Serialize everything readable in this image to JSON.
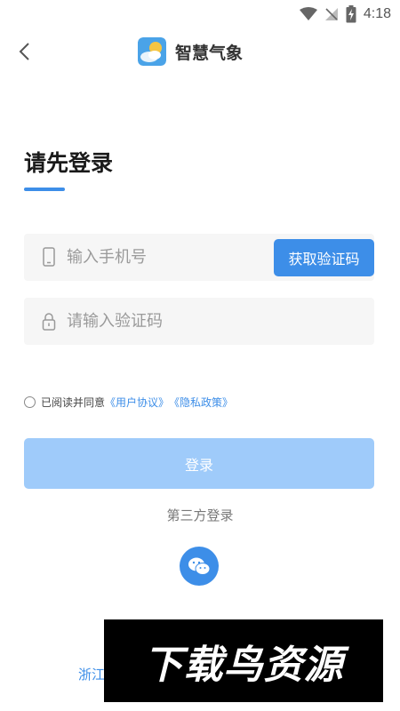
{
  "status_bar": {
    "time": "4:18",
    "icons": [
      "wifi-icon",
      "signal-off-icon",
      "battery-charging-icon"
    ]
  },
  "nav": {
    "back_icon": "chevron-left-icon",
    "app_title": "智慧气象"
  },
  "login": {
    "title": "请先登录",
    "phone_placeholder": "输入手机号",
    "get_code_label": "获取验证码",
    "code_placeholder": "请输入验证码",
    "agreement_prefix": "已阅读并同意",
    "user_agreement_link": "《用户协议》",
    "privacy_link": "《隐私政策》",
    "login_label": "登录",
    "third_party_label": "第三方登录"
  },
  "footer": {
    "partial_text": "浙江"
  },
  "watermark": {
    "text": "下载鸟资源"
  },
  "colors": {
    "accent": "#3d8ee8",
    "login_button_disabled": "#9fcbfa",
    "input_background": "#f6f6f6"
  }
}
